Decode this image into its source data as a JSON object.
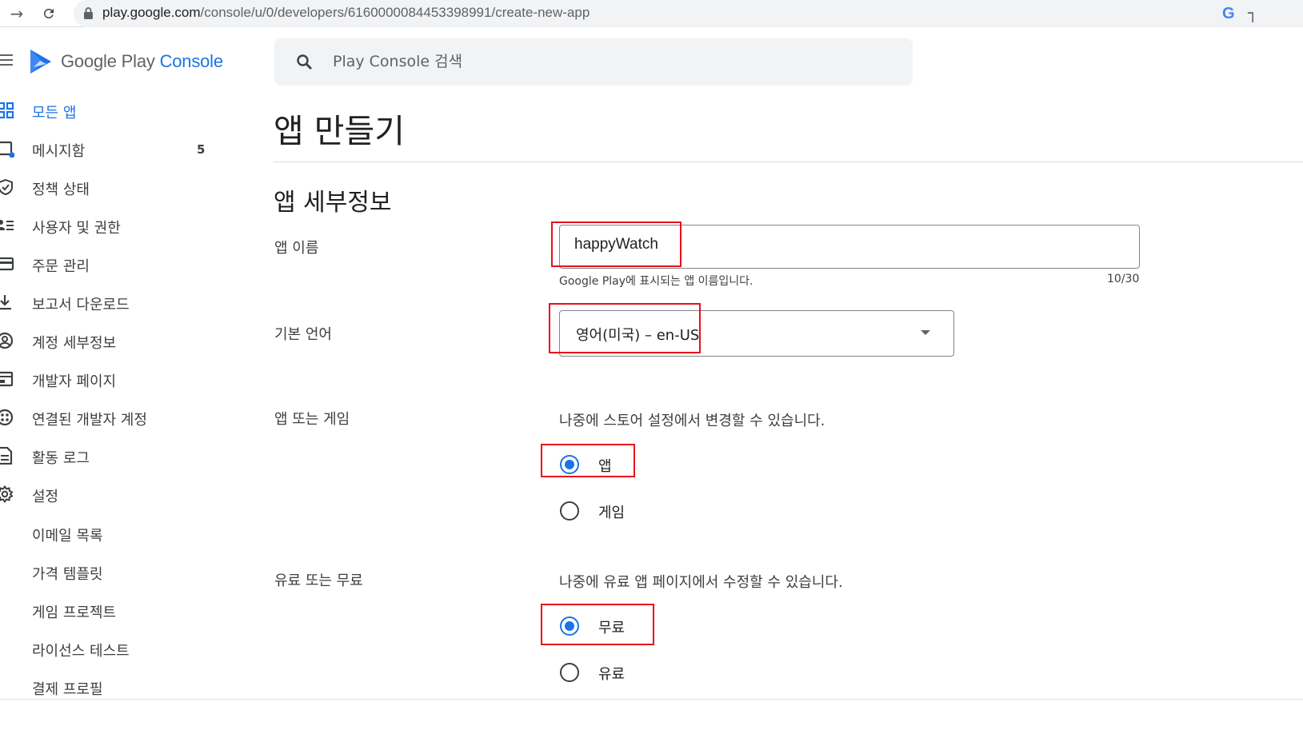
{
  "browser": {
    "url_host": "play.google.com",
    "url_path": "/console/u/0/developers/6160000084453398991/create-new-app"
  },
  "brand": {
    "name_prefix": "Google Play ",
    "name_suffix": "Console"
  },
  "search": {
    "placeholder": "Play Console 검색"
  },
  "sidebar": {
    "items": [
      {
        "label": "모든 앱",
        "icon": "grid-icon",
        "active": true
      },
      {
        "label": "메시지함",
        "icon": "inbox-icon",
        "count": "5"
      },
      {
        "label": "정책 상태",
        "icon": "shield-check-icon"
      },
      {
        "label": "사용자 및 권한",
        "icon": "users-list-icon"
      },
      {
        "label": "주문 관리",
        "icon": "credit-card-icon"
      },
      {
        "label": "보고서 다운로드",
        "icon": "download-icon"
      },
      {
        "label": "계정 세부정보",
        "icon": "account-circle-icon"
      },
      {
        "label": "개발자 페이지",
        "icon": "developer-page-icon"
      },
      {
        "label": "연결된 개발자 계정",
        "icon": "linked-accounts-icon"
      },
      {
        "label": "활동 로그",
        "icon": "document-icon"
      },
      {
        "label": "설정",
        "icon": "gear-icon"
      },
      {
        "label": "이메일 목록"
      },
      {
        "label": "가격 템플릿"
      },
      {
        "label": "게임 프로젝트"
      },
      {
        "label": "라이선스 테스트"
      },
      {
        "label": "결제 프로필"
      }
    ]
  },
  "main": {
    "title": "앱 만들기",
    "section_title": "앱 세부정보",
    "app_name": {
      "label": "앱 이름",
      "value": "happyWatch",
      "helper": "Google Play에 표시되는 앱 이름입니다.",
      "counter": "10/30"
    },
    "default_language": {
      "label": "기본 언어",
      "value": "영어(미국) – en-US"
    },
    "app_or_game": {
      "label": "앱 또는 게임",
      "note": "나중에 스토어 설정에서 변경할 수 있습니다.",
      "options": [
        {
          "label": "앱",
          "selected": true
        },
        {
          "label": "게임",
          "selected": false
        }
      ]
    },
    "free_or_paid": {
      "label": "유료 또는 무료",
      "note": "나중에 유료 앱 페이지에서 수정할 수 있습니다.",
      "options": [
        {
          "label": "무료",
          "selected": true
        },
        {
          "label": "유료",
          "selected": false
        }
      ]
    }
  },
  "colors": {
    "accent": "#1a73e8",
    "highlight_box": "#e8101a"
  }
}
